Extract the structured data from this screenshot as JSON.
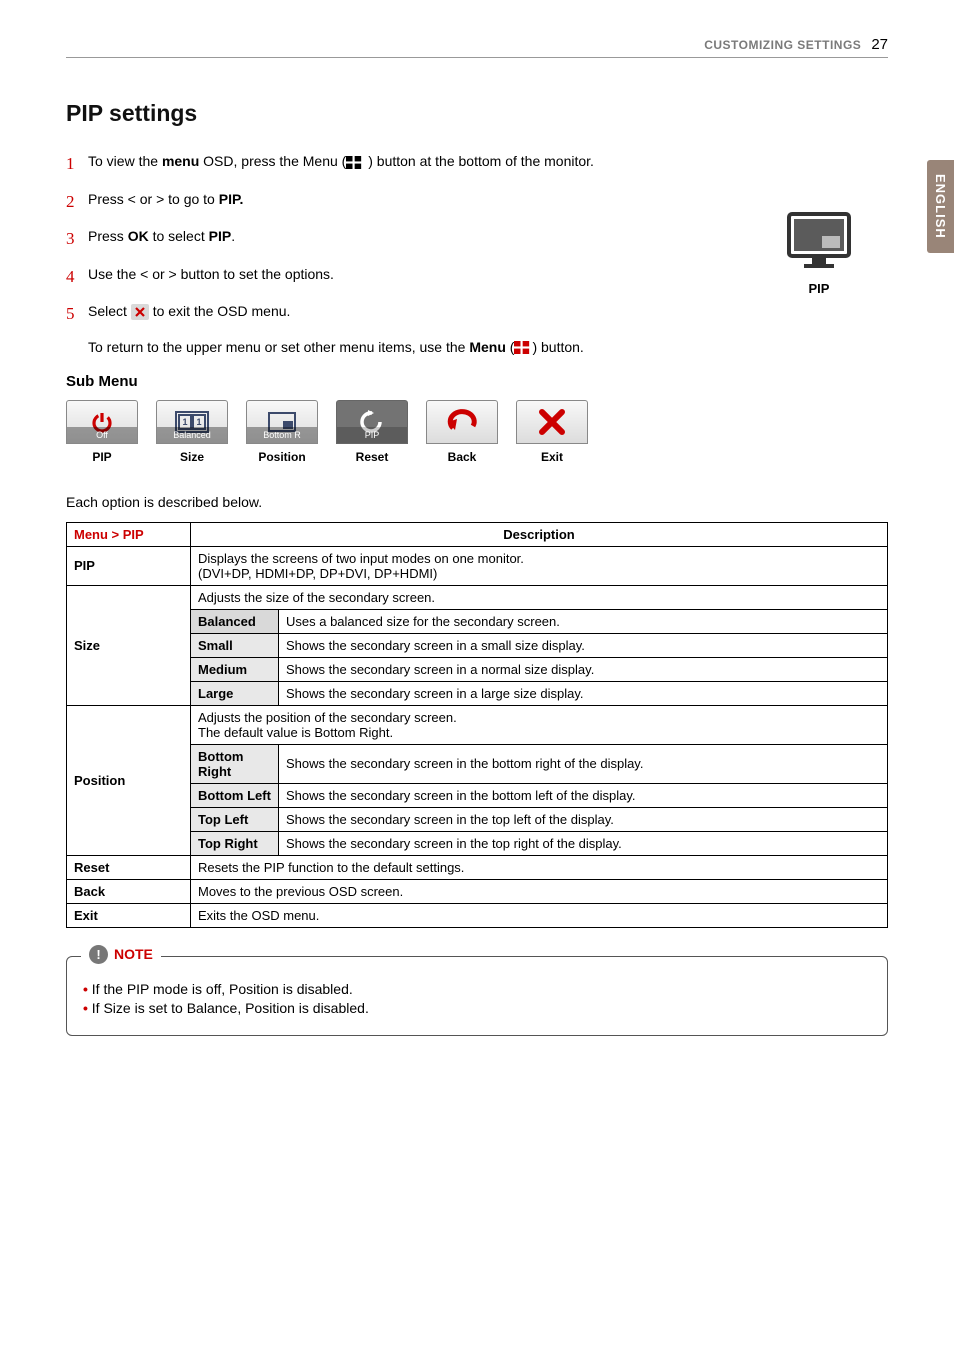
{
  "header": {
    "section": "CUSTOMIZING SETTINGS",
    "page": "27"
  },
  "sideTab": "ENGLISH",
  "title": "PIP settings",
  "steps": [
    {
      "n": "1",
      "before": "To view the ",
      "b1": "menu",
      "mid": " OSD, press the Menu (",
      "after": " ) button at the bottom of the monitor."
    },
    {
      "n": "2",
      "before": "Press < or > to go to ",
      "b1": "PIP.",
      "after": ""
    },
    {
      "n": "3",
      "before": "Press ",
      "b1": "OK",
      "mid": " to select ",
      "b2": "PIP",
      "after": "."
    },
    {
      "n": "4",
      "before": "Use the < or > button to set the options."
    },
    {
      "n": "5",
      "before": "Select ",
      "after": " to exit the OSD menu."
    }
  ],
  "step5sub": {
    "before": "To return to the upper menu or set other menu items, use the ",
    "b1": "Menu",
    "mid": " (",
    "after": ") button."
  },
  "pipIllustration": {
    "label": "PIP"
  },
  "subMenuHeading": "Sub Menu",
  "subMenu": [
    {
      "caption": "Off",
      "label": "PIP"
    },
    {
      "caption": "Balanced",
      "label": "Size"
    },
    {
      "caption": "Bottom R",
      "label": "Position"
    },
    {
      "caption": "PIP",
      "label": "Reset"
    },
    {
      "caption": "",
      "label": "Back"
    },
    {
      "caption": "",
      "label": "Exit"
    }
  ],
  "tableIntro": "Each option is described below.",
  "table": {
    "menuHeader": "Menu > PIP",
    "descHeader": "Description",
    "rows": {
      "pip": {
        "name": "PIP",
        "desc": "Displays the screens of two input modes on one monitor.\n(DVI+DP, HDMI+DP, DP+DVI, DP+HDMI)"
      },
      "size": {
        "name": "Size",
        "desc": "Adjusts the size of the secondary screen.",
        "opts": [
          {
            "name": "Balanced",
            "desc": "Uses a balanced size for the secondary screen."
          },
          {
            "name": "Small",
            "desc": "Shows the secondary screen in a small size display."
          },
          {
            "name": "Medium",
            "desc": "Shows the secondary screen in a normal size display."
          },
          {
            "name": "Large",
            "desc": "Shows the secondary screen in a large size display."
          }
        ]
      },
      "position": {
        "name": "Position",
        "desc": "Adjusts the position of the secondary screen.\nThe default value is Bottom Right.",
        "opts": [
          {
            "name": "Bottom Right",
            "desc": "Shows the secondary screen in the bottom right of the display."
          },
          {
            "name": "Bottom Left",
            "desc": "Shows the secondary screen in the bottom left of the display."
          },
          {
            "name": "Top Left",
            "desc": "Shows the secondary screen in the top left of the display."
          },
          {
            "name": "Top Right",
            "desc": "Shows the secondary screen in the top right of the display."
          }
        ]
      },
      "reset": {
        "name": "Reset",
        "desc": "Resets the PIP function to the default settings."
      },
      "back": {
        "name": "Back",
        "desc": "Moves to the previous OSD screen."
      },
      "exit": {
        "name": "Exit",
        "desc": "Exits the OSD menu."
      }
    }
  },
  "note": {
    "label": "NOTE",
    "items": [
      "If the PIP mode is off, Position is disabled.",
      "If Size is set to Balance, Position is disabled."
    ]
  }
}
